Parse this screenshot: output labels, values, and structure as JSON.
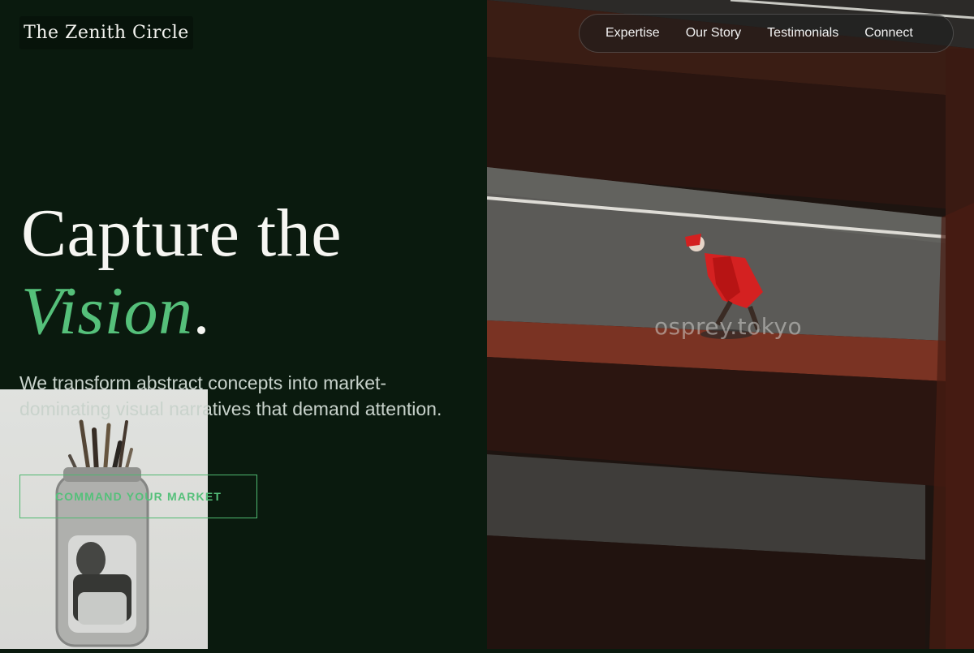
{
  "brand": {
    "name": "The Zenith Circle"
  },
  "nav": {
    "items": [
      {
        "label": "Expertise"
      },
      {
        "label": "Our Story"
      },
      {
        "label": "Testimonials"
      },
      {
        "label": "Connect"
      }
    ]
  },
  "hero": {
    "title_line1": "Capture the",
    "title_accent": "Vision",
    "title_period": ".",
    "tagline": "We transform abstract concepts into market-dominating visual narratives that demand attention.",
    "cta_label": "COMMAND YOUR MARKET"
  },
  "photo": {
    "watermark": "osprey.tokyo"
  },
  "colors": {
    "background": "#0a1a0e",
    "accent": "#55c07a",
    "text": "#f6f6f2"
  }
}
